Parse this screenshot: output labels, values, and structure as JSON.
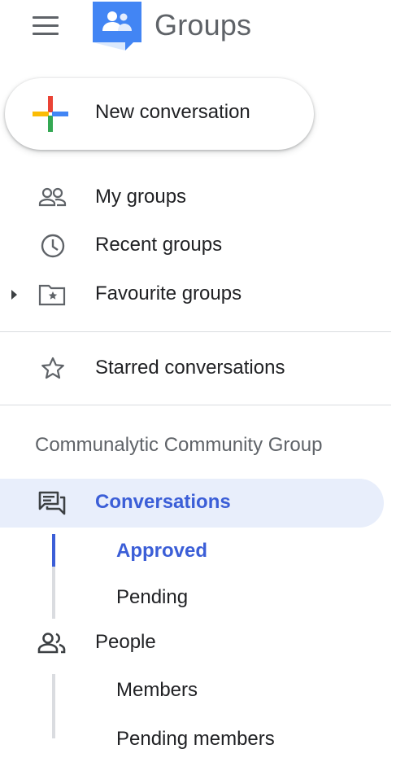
{
  "app": {
    "title": "Groups"
  },
  "compose": {
    "label": "New conversation"
  },
  "nav": {
    "my_groups": "My groups",
    "recent_groups": "Recent groups",
    "favourite_groups": "Favourite groups",
    "starred": "Starred conversations"
  },
  "group": {
    "name": "Communalytic Community Group",
    "conversations": "Conversations",
    "approved": "Approved",
    "pending": "Pending",
    "people": "People",
    "members": "Members",
    "pending_members": "Pending members"
  },
  "icons": {
    "menu": "hamburger-menu-icon",
    "logo": "google-groups-logo",
    "compose": "colored-plus-icon",
    "my_groups": "people-outline-icon",
    "recent": "clock-icon",
    "favourite": "folder-star-icon",
    "starred": "star-outline-icon",
    "conversations": "chat-bubbles-icon",
    "people": "people-icon"
  },
  "colors": {
    "accent": "#3b5ed7",
    "active_bg": "#e8eefb",
    "logo_blue": "#4285f4"
  }
}
